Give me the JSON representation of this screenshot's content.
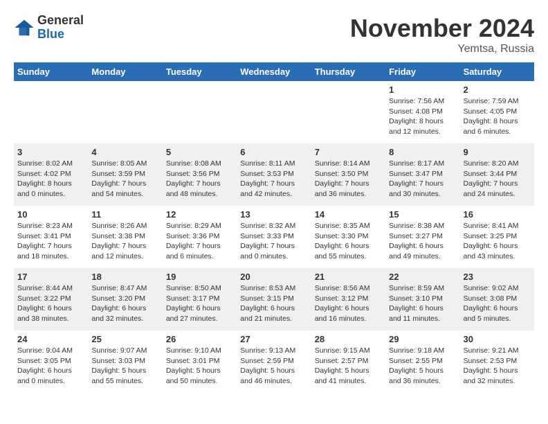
{
  "logo": {
    "general": "General",
    "blue": "Blue"
  },
  "title": {
    "month": "November 2024",
    "location": "Yemtsa, Russia"
  },
  "weekdays": [
    "Sunday",
    "Monday",
    "Tuesday",
    "Wednesday",
    "Thursday",
    "Friday",
    "Saturday"
  ],
  "weeks": [
    [
      {
        "day": "",
        "content": ""
      },
      {
        "day": "",
        "content": ""
      },
      {
        "day": "",
        "content": ""
      },
      {
        "day": "",
        "content": ""
      },
      {
        "day": "",
        "content": ""
      },
      {
        "day": "1",
        "content": "Sunrise: 7:56 AM\nSunset: 4:08 PM\nDaylight: 8 hours\nand 12 minutes."
      },
      {
        "day": "2",
        "content": "Sunrise: 7:59 AM\nSunset: 4:05 PM\nDaylight: 8 hours\nand 6 minutes."
      }
    ],
    [
      {
        "day": "3",
        "content": "Sunrise: 8:02 AM\nSunset: 4:02 PM\nDaylight: 8 hours\nand 0 minutes."
      },
      {
        "day": "4",
        "content": "Sunrise: 8:05 AM\nSunset: 3:59 PM\nDaylight: 7 hours\nand 54 minutes."
      },
      {
        "day": "5",
        "content": "Sunrise: 8:08 AM\nSunset: 3:56 PM\nDaylight: 7 hours\nand 48 minutes."
      },
      {
        "day": "6",
        "content": "Sunrise: 8:11 AM\nSunset: 3:53 PM\nDaylight: 7 hours\nand 42 minutes."
      },
      {
        "day": "7",
        "content": "Sunrise: 8:14 AM\nSunset: 3:50 PM\nDaylight: 7 hours\nand 36 minutes."
      },
      {
        "day": "8",
        "content": "Sunrise: 8:17 AM\nSunset: 3:47 PM\nDaylight: 7 hours\nand 30 minutes."
      },
      {
        "day": "9",
        "content": "Sunrise: 8:20 AM\nSunset: 3:44 PM\nDaylight: 7 hours\nand 24 minutes."
      }
    ],
    [
      {
        "day": "10",
        "content": "Sunrise: 8:23 AM\nSunset: 3:41 PM\nDaylight: 7 hours\nand 18 minutes."
      },
      {
        "day": "11",
        "content": "Sunrise: 8:26 AM\nSunset: 3:38 PM\nDaylight: 7 hours\nand 12 minutes."
      },
      {
        "day": "12",
        "content": "Sunrise: 8:29 AM\nSunset: 3:36 PM\nDaylight: 7 hours\nand 6 minutes."
      },
      {
        "day": "13",
        "content": "Sunrise: 8:32 AM\nSunset: 3:33 PM\nDaylight: 7 hours\nand 0 minutes."
      },
      {
        "day": "14",
        "content": "Sunrise: 8:35 AM\nSunset: 3:30 PM\nDaylight: 6 hours\nand 55 minutes."
      },
      {
        "day": "15",
        "content": "Sunrise: 8:38 AM\nSunset: 3:27 PM\nDaylight: 6 hours\nand 49 minutes."
      },
      {
        "day": "16",
        "content": "Sunrise: 8:41 AM\nSunset: 3:25 PM\nDaylight: 6 hours\nand 43 minutes."
      }
    ],
    [
      {
        "day": "17",
        "content": "Sunrise: 8:44 AM\nSunset: 3:22 PM\nDaylight: 6 hours\nand 38 minutes."
      },
      {
        "day": "18",
        "content": "Sunrise: 8:47 AM\nSunset: 3:20 PM\nDaylight: 6 hours\nand 32 minutes."
      },
      {
        "day": "19",
        "content": "Sunrise: 8:50 AM\nSunset: 3:17 PM\nDaylight: 6 hours\nand 27 minutes."
      },
      {
        "day": "20",
        "content": "Sunrise: 8:53 AM\nSunset: 3:15 PM\nDaylight: 6 hours\nand 21 minutes."
      },
      {
        "day": "21",
        "content": "Sunrise: 8:56 AM\nSunset: 3:12 PM\nDaylight: 6 hours\nand 16 minutes."
      },
      {
        "day": "22",
        "content": "Sunrise: 8:59 AM\nSunset: 3:10 PM\nDaylight: 6 hours\nand 11 minutes."
      },
      {
        "day": "23",
        "content": "Sunrise: 9:02 AM\nSunset: 3:08 PM\nDaylight: 6 hours\nand 5 minutes."
      }
    ],
    [
      {
        "day": "24",
        "content": "Sunrise: 9:04 AM\nSunset: 3:05 PM\nDaylight: 6 hours\nand 0 minutes."
      },
      {
        "day": "25",
        "content": "Sunrise: 9:07 AM\nSunset: 3:03 PM\nDaylight: 5 hours\nand 55 minutes."
      },
      {
        "day": "26",
        "content": "Sunrise: 9:10 AM\nSunset: 3:01 PM\nDaylight: 5 hours\nand 50 minutes."
      },
      {
        "day": "27",
        "content": "Sunrise: 9:13 AM\nSunset: 2:59 PM\nDaylight: 5 hours\nand 46 minutes."
      },
      {
        "day": "28",
        "content": "Sunrise: 9:15 AM\nSunset: 2:57 PM\nDaylight: 5 hours\nand 41 minutes."
      },
      {
        "day": "29",
        "content": "Sunrise: 9:18 AM\nSunset: 2:55 PM\nDaylight: 5 hours\nand 36 minutes."
      },
      {
        "day": "30",
        "content": "Sunrise: 9:21 AM\nSunset: 2:53 PM\nDaylight: 5 hours\nand 32 minutes."
      }
    ]
  ]
}
